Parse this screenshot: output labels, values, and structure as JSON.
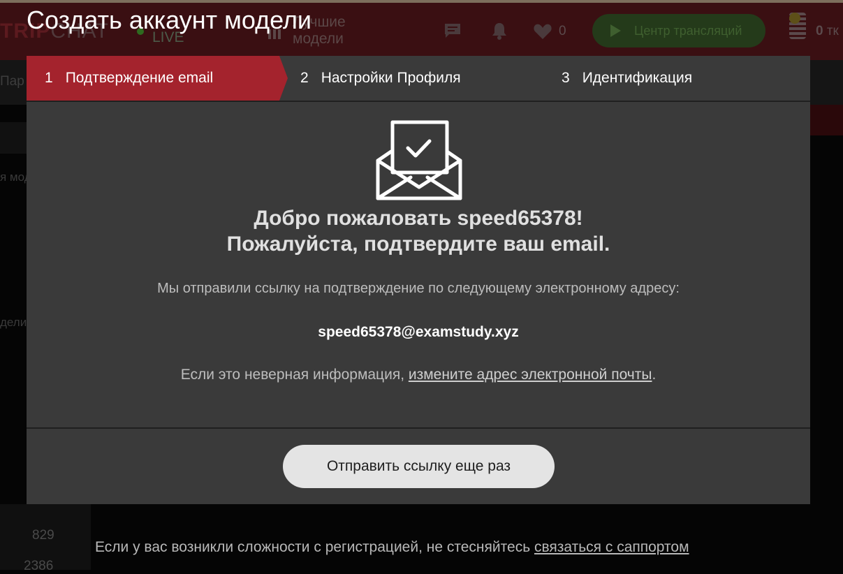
{
  "background": {
    "logo_bold": "TRIP",
    "logo_light": "CHAT",
    "live_label": "LIVE",
    "best_models_line1": "Лучшие",
    "best_models_line2": "модели",
    "likes_count": "0",
    "broadcast_center": "Центр трансляций",
    "tokens_count": "0",
    "tokens_suffix": "тк",
    "sub_menu_fragment": "Пар",
    "side_text_1": "я мод",
    "side_text_2": "дели",
    "num_1": "829",
    "num_2": "2386",
    "support_text": "Если у вас возникли сложности с регистрацией, не стесняйтесь ",
    "support_link": "связаться с саппортом"
  },
  "modal": {
    "title": "Создать аккаунт модели",
    "steps": [
      {
        "num": "1",
        "label": "Подтверждение email"
      },
      {
        "num": "2",
        "label": "Настройки Профиля"
      },
      {
        "num": "3",
        "label": "Идентификация"
      }
    ],
    "welcome_line1": "Добро пожаловать speed65378!",
    "welcome_line2": "Пожалуйста, подтвердите ваш email.",
    "sent_text": "Мы отправили ссылку на подтверждение по следующему электронному адресу:",
    "email": "speed65378@examstudy.xyz",
    "wrong_text": "Если это неверная информация, ",
    "change_email_link": "измените адрес электронной почты",
    "wrong_suffix": ".",
    "resend_button": "Отправить ссылку еще раз"
  },
  "colors": {
    "active_step": "#a4232d",
    "modal_bg": "#3a3a3a",
    "header_bg": "#3a0f12"
  }
}
